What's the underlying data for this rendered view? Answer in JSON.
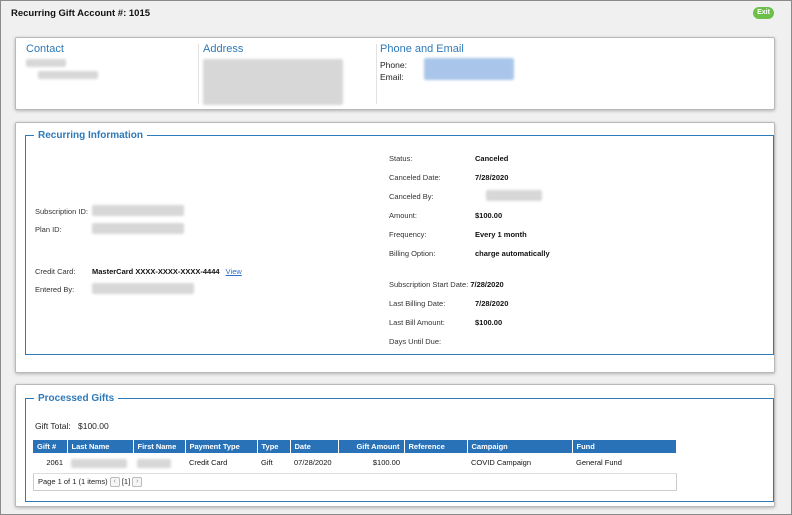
{
  "header": {
    "title": "Recurring Gift Account #: 1015",
    "exit_label": "Exit"
  },
  "contact": {
    "contact_heading": "Contact",
    "address_heading": "Address",
    "phone_email_heading": "Phone and Email",
    "phone_label": "Phone:",
    "email_label": "Email:"
  },
  "recurring": {
    "legend": "Recurring Information",
    "subscription_id_label": "Subscription ID:",
    "plan_id_label": "Plan ID:",
    "credit_card_label": "Credit Card:",
    "credit_card_value": "MasterCard XXXX-XXXX-XXXX-4444",
    "view_link": "View",
    "entered_by_label": "Entered By:",
    "status_label": "Status:",
    "status_value": "Canceled",
    "canceled_date_label": "Canceled Date:",
    "canceled_date_value": "7/28/2020",
    "canceled_by_label": "Canceled By:",
    "amount_label": "Amount:",
    "amount_value": "$100.00",
    "frequency_label": "Frequency:",
    "frequency_value": "Every 1 month",
    "billing_option_label": "Billing Option:",
    "billing_option_value": "charge automatically",
    "start_date_label": "Subscription Start Date:",
    "start_date_value": "7/28/2020",
    "last_billing_label": "Last Billing Date:",
    "last_billing_value": "7/28/2020",
    "last_bill_amount_label": "Last Bill Amount:",
    "last_bill_amount_value": "$100.00",
    "days_until_due_label": "Days Until Due:"
  },
  "gifts": {
    "legend": "Processed Gifts",
    "total_label": "Gift Total:",
    "total_value": "$100.00",
    "columns": [
      "Gift #",
      "Last Name",
      "First Name",
      "Payment Type",
      "Type",
      "Date",
      "Gift Amount",
      "Reference",
      "Campaign",
      "Fund"
    ],
    "rows": [
      {
        "gift_no": "2061",
        "payment_type": "Credit Card",
        "type": "Gift",
        "date": "07/28/2020",
        "amount": "$100.00",
        "reference": "",
        "campaign": "COVID Campaign",
        "fund": "General Fund"
      }
    ],
    "pager_text": "Page 1 of 1 (1 items)",
    "pager_current": "[1]",
    "prev_icon": "chevron-left-icon",
    "next_icon": "chevron-right-icon"
  },
  "colors": {
    "accent": "#2e79b9",
    "header_blue": "#2a72b8",
    "exit_green": "#6cc04a"
  }
}
